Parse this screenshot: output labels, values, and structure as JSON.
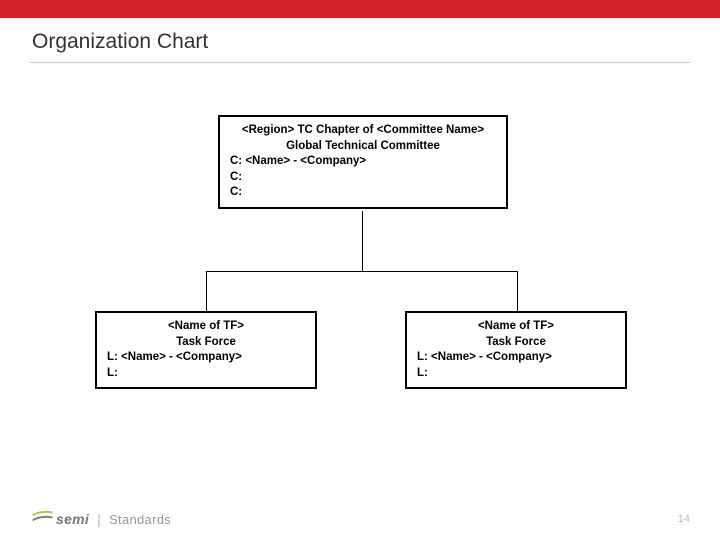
{
  "header": {
    "title": "Organization Chart"
  },
  "chart": {
    "top": {
      "line1": "<Region> TC Chapter of <Committee Name>",
      "line2": "Global Technical Committee",
      "c1": "C: <Name> - <Company>",
      "c2": "C:",
      "c3": "C:"
    },
    "children": [
      {
        "title": "<Name of TF>",
        "subtitle": "Task Force",
        "l1": "L: <Name> - <Company>",
        "l2": "L:"
      },
      {
        "title": "<Name of TF>",
        "subtitle": "Task Force",
        "l1": "L: <Name> - <Company>",
        "l2": "L:"
      }
    ]
  },
  "footer": {
    "brand_semi": "semi",
    "brand_standards": "Standards",
    "page_number": "14"
  }
}
